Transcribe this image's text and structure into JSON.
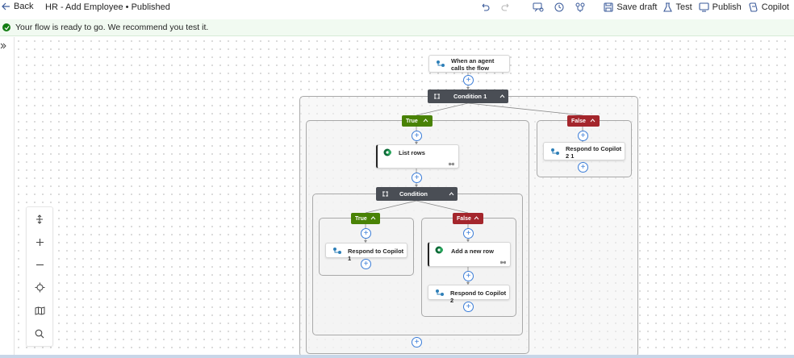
{
  "topbar": {
    "back_label": "Back",
    "title": "HR - Add Employee • Published",
    "save_draft": "Save draft",
    "test": "Test",
    "publish": "Publish",
    "copilot": "Copilot"
  },
  "banner": {
    "message": "Your flow is ready to go. We recommend you test it."
  },
  "flow": {
    "trigger_label": "When an agent calls the flow",
    "condition1_label": "Condition 1",
    "true_label": "True",
    "false_label": "False",
    "list_rows_label": "List rows",
    "respond_copilot_2_1_label": "Respond to Copilot 2 1",
    "condition_label": "Condition",
    "respond_copilot_1_label": "Respond to Copilot 1",
    "add_new_row_label": "Add a new row",
    "respond_copilot_2_label": "Respond to Copilot 2"
  },
  "colors": {
    "true_branch": "#498205",
    "false_branch": "#a4262c",
    "condition": "#4a4e55",
    "success": "#107c10",
    "accent": "#3b7dd8"
  },
  "icons": [
    "back-arrow-icon",
    "undo-icon",
    "redo-icon",
    "flow-checker-icon",
    "version-history-icon",
    "flow-stem-icon",
    "save-icon",
    "test-flask-icon",
    "publish-icon",
    "copilot-icon",
    "check-circle-icon",
    "expand-chevrons-icon",
    "fit-view-icon",
    "zoom-in-icon",
    "zoom-out-icon",
    "center-icon",
    "minimap-icon",
    "search-icon"
  ]
}
